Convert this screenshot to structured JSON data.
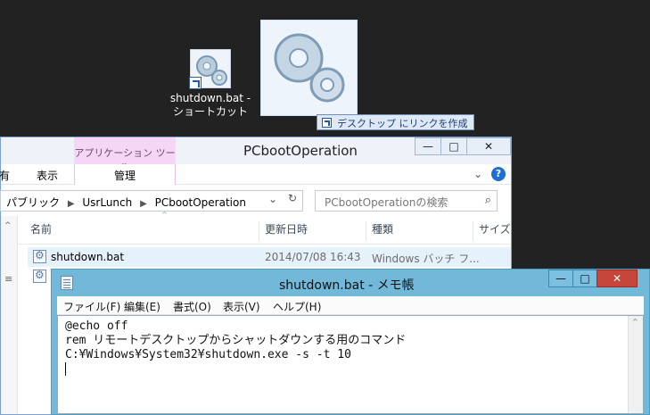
{
  "desktop": {
    "shortcut_icon": {
      "label_line1": "shutdown.bat -",
      "label_line2": "ショートカット"
    },
    "tooltip": "デスクトップ にリンクを作成"
  },
  "explorer": {
    "context_tab": "アプリケーション ツール",
    "title": "PCbootOperation",
    "window_buttons": {
      "minimize": "—",
      "maximize": "□",
      "close": "✕"
    },
    "ribbon": {
      "item_partial": "有",
      "view": "表示",
      "manage": "管理",
      "expand_glyph": "⌄",
      "help_glyph": "?"
    },
    "breadcrumb": [
      "パブリック",
      "UsrLunch",
      "PCbootOperation"
    ],
    "breadcrumb_sep": "▶",
    "address_dropdown": "⌄",
    "refresh": "↻",
    "search_placeholder": "PCbootOperationの検索",
    "search_glyph": "⌕",
    "columns": {
      "name": "名前",
      "date": "更新日時",
      "type": "種類",
      "size": "サイズ"
    },
    "sort_glyph": "^",
    "nav_scroll_glyph": "^",
    "nav_grip_glyph": "≡",
    "files": [
      {
        "name": "shutdown.bat",
        "date": "2014/07/08 16:43",
        "type": "Windows バッチ フ..."
      }
    ]
  },
  "notepad": {
    "title": "shutdown.bat - メモ帳",
    "window_buttons": {
      "minimize": "—",
      "maximize": "□",
      "close": "✕"
    },
    "menu": [
      "ファイル(F)",
      "編集(E)",
      "書式(O)",
      "表示(V)",
      "ヘルプ(H)"
    ],
    "lines": [
      "@echo off",
      "rem リモートデスクトップからシャットダウンする用のコマンド",
      "C:¥Windows¥System32¥shutdown.exe -s -t 10"
    ],
    "scroll_up_glyph": "^"
  },
  "icons": {
    "file": "batch-file-icon",
    "gears": "gears-icon",
    "shortcut": "shortcut-arrow-icon",
    "notepad": "notepad-icon"
  },
  "colors": {
    "desktop_bg": "#222222",
    "context_tab": "#f5d7f5",
    "notepad_frame": "#71b8d9",
    "close_red": "#c7463c",
    "help_blue": "#1d6fd1"
  }
}
